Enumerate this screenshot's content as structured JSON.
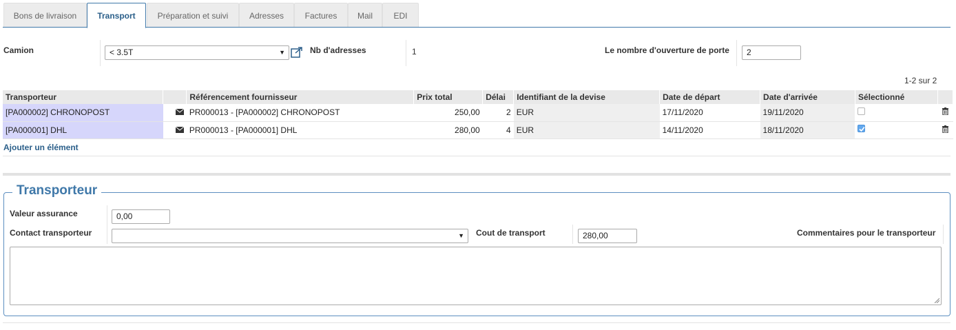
{
  "tabs": [
    {
      "label": "Bons de livraison",
      "active": false
    },
    {
      "label": "Transport",
      "active": true
    },
    {
      "label": "Préparation et suivi",
      "active": false
    },
    {
      "label": "Adresses",
      "active": false
    },
    {
      "label": "Factures",
      "active": false
    },
    {
      "label": "Mail",
      "active": false
    },
    {
      "label": "EDI",
      "active": false
    }
  ],
  "form": {
    "camion_label": "Camion",
    "camion_value": "< 3.5T",
    "nb_adresses_label": "Nb d'adresses",
    "nb_adresses_value": "1",
    "ouverture_label": "Le nombre d'ouverture de porte",
    "ouverture_value": "2"
  },
  "table": {
    "pagination": "1-2 sur 2",
    "headers": [
      "Transporteur",
      "Référencement fournisseur",
      "Prix total",
      "Délai",
      "Identifiant de la devise",
      "Date de départ",
      "Date d'arrivée",
      "Sélectionné"
    ],
    "rows": [
      {
        "transporteur": "[PA000002] CHRONOPOST",
        "ref": "PR000013 - [PA000002] CHRONOPOST",
        "prix": "250,00",
        "delai": "2",
        "devise": "EUR",
        "depart": "17/11/2020",
        "arrivee": "19/11/2020",
        "selected": false
      },
      {
        "transporteur": "[PA000001] DHL",
        "ref": "PR000013 - [PA000001] DHL",
        "prix": "280,00",
        "delai": "4",
        "devise": "EUR",
        "depart": "14/11/2020",
        "arrivee": "18/11/2020",
        "selected": true
      }
    ],
    "add_label": "Ajouter un élément"
  },
  "transporteur_section": {
    "legend": "Transporteur",
    "valeur_assurance_label": "Valeur assurance",
    "valeur_assurance_value": "0,00",
    "contact_label": "Contact transporteur",
    "contact_value": "",
    "cout_label": "Cout de transport",
    "cout_value": "280,00",
    "commentaires_label": "Commentaires pour le transporteur",
    "commentaires_value": ""
  },
  "colors": {
    "accent": "#3f78a9",
    "transporteur_cell": "#d6d6fb",
    "checkbox_checked": "#64a9ee"
  },
  "icons": {
    "external_link": "external-link-icon",
    "mail": "envelope-icon",
    "delete": "trash-icon"
  }
}
